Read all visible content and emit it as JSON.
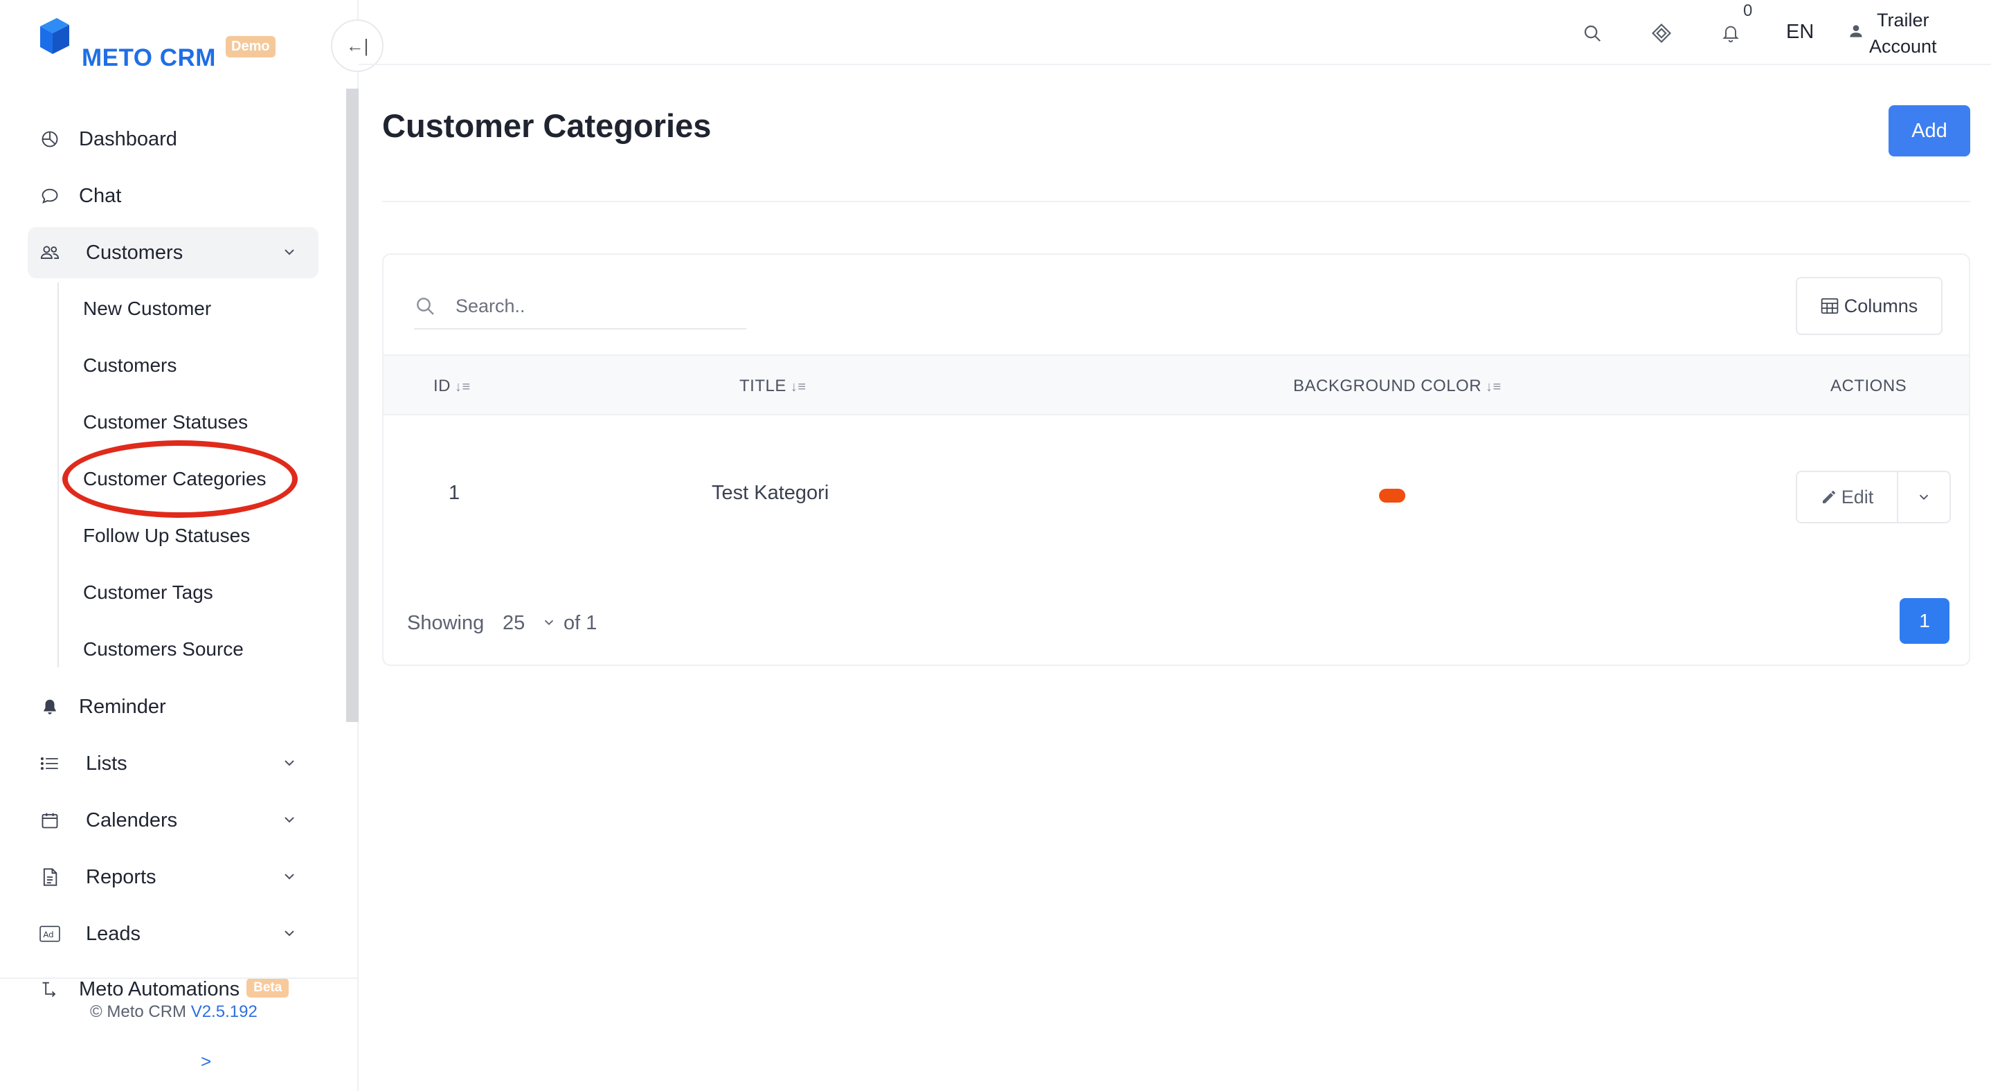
{
  "brand": {
    "name": "METO CRM",
    "badge": "Demo",
    "color": "#1f6fe5"
  },
  "topbar": {
    "notifications_count": "0",
    "language": "EN",
    "user_line1": "Trailer",
    "user_line2": "Account"
  },
  "sidebar": {
    "dashboard": "Dashboard",
    "chat": "Chat",
    "customers_group": "Customers",
    "customers_sub": [
      "New Customer",
      "Customers",
      "Customer Statuses",
      "Customer Categories",
      "Follow Up Statuses",
      "Customer Tags",
      "Customers Source"
    ],
    "reminder": "Reminder",
    "lists": "Lists",
    "calenders": "Calenders",
    "reports": "Reports",
    "leads": "Leads",
    "automations": "Meto Automations",
    "automations_badge": "Beta",
    "copyright": "© Meto CRM",
    "version": "V2.5.192",
    "expand": ">",
    "collapse": "←|"
  },
  "page": {
    "title": "Customer Categories",
    "add_label": "Add"
  },
  "table": {
    "search_placeholder": "Search..",
    "columns_label": "Columns",
    "headers": {
      "id": "ID",
      "title": "TITLE",
      "bg_color": "BACKGROUND COLOR",
      "actions": "ACTIONS"
    },
    "rows": [
      {
        "id": "1",
        "title": "Test Kategori",
        "color": "#f04e0f",
        "edit_label": "Edit"
      }
    ],
    "footer": {
      "showing": "Showing",
      "page_size": "25",
      "of_total": "of 1",
      "current_page": "1"
    }
  },
  "colors": {
    "accent": "#3d7ff0",
    "highlight": "#e02a1b"
  }
}
